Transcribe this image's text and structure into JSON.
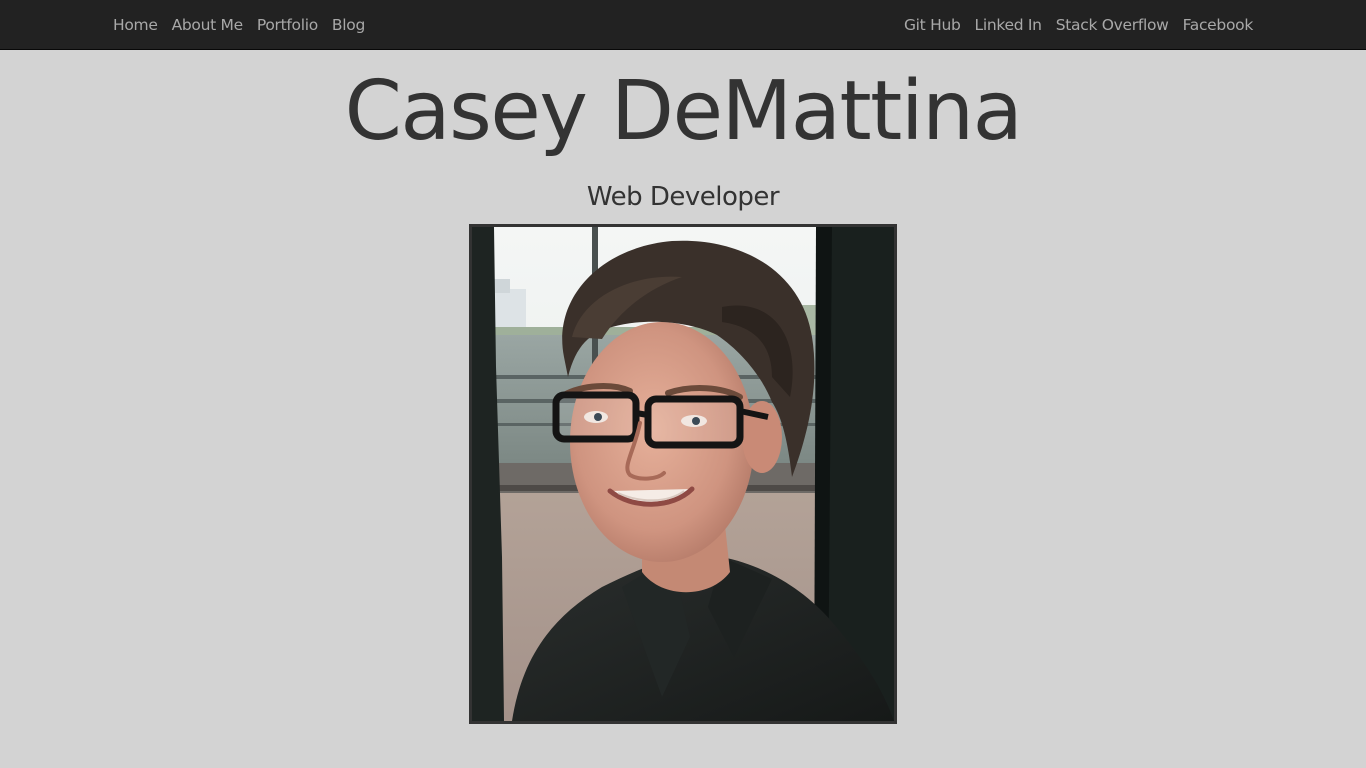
{
  "nav": {
    "left": [
      {
        "label": "Home"
      },
      {
        "label": "About Me"
      },
      {
        "label": "Portfolio"
      },
      {
        "label": "Blog"
      }
    ],
    "right": [
      {
        "label": "Git Hub"
      },
      {
        "label": "Linked In"
      },
      {
        "label": "Stack Overflow"
      },
      {
        "label": "Facebook"
      }
    ]
  },
  "hero": {
    "name": "Casey DeMattina",
    "title": "Web Developer"
  },
  "colors": {
    "page_background": "#d3d3d3",
    "navbar_background": "#222222",
    "nav_text": "#a8a8a8",
    "heading_text": "#333333"
  }
}
